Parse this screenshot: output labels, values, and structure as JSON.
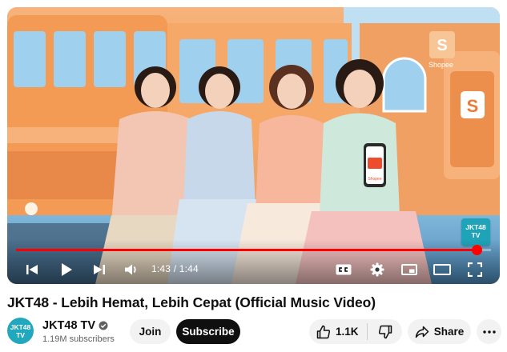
{
  "player": {
    "watermark_line1": "JKT48",
    "watermark_line2": "TV",
    "shop_sign": "Shopee",
    "phone_brand": "Shopee",
    "current_time": "1:43",
    "duration": "1:44",
    "time_separator": " / ",
    "progress_fraction": 0.97,
    "accent_color": "#ff0000",
    "controls": {
      "prev_icon": "skip-previous-icon",
      "play_icon": "play-icon",
      "next_icon": "skip-next-icon",
      "volume_icon": "volume-icon",
      "captions_icon": "captions-icon",
      "settings_icon": "settings-gear-icon",
      "miniplayer_icon": "miniplayer-icon",
      "theater_icon": "theater-mode-icon",
      "fullscreen_icon": "fullscreen-icon"
    }
  },
  "video": {
    "title": "JKT48 - Lebih Hemat, Lebih Cepat (Official Music Video)"
  },
  "channel": {
    "avatar_line1": "JKT48",
    "avatar_line2": "TV",
    "name": "JKT48 TV",
    "subscribers": "1.19M subscribers",
    "verified_icon": "verified-check-icon"
  },
  "actions": {
    "join_label": "Join",
    "subscribe_label": "Subscribe",
    "like_count": "1.1K",
    "like_icon": "thumbs-up-icon",
    "dislike_icon": "thumbs-down-icon",
    "share_label": "Share",
    "share_icon": "share-arrow-icon",
    "more_icon": "more-horizontal-icon"
  }
}
